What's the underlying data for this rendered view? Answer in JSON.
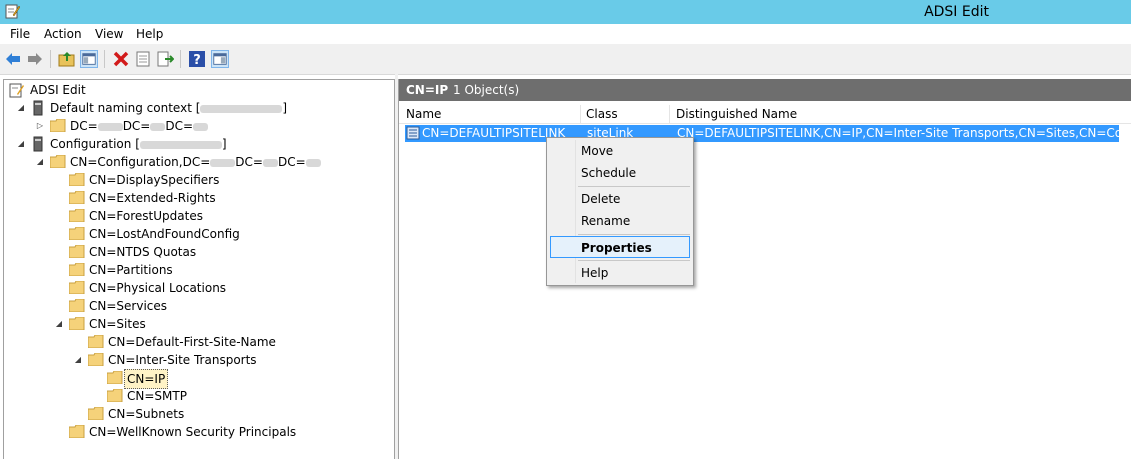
{
  "window": {
    "title": "ADSI Edit"
  },
  "menu": [
    "File",
    "Action",
    "View",
    "Help"
  ],
  "toolbar": [
    "back-arrow-icon",
    "forward-arrow-icon",
    "up-folder-icon",
    "show-hide-tree-icon",
    "delete-icon",
    "properties-sheet-icon",
    "export-list-icon",
    "help-icon",
    "show-hide-action-pane-icon"
  ],
  "tree": {
    "root": "ADSI Edit",
    "default_ctx": {
      "label": "Default naming context [",
      "close": "]"
    },
    "dc_node": {
      "p1": "DC=",
      "p2": "DC=",
      "p3": "DC="
    },
    "config_ctx": {
      "label": "Configuration [",
      "close": "]"
    },
    "config_node": {
      "p1": "CN=Configuration,DC=",
      "p2": "DC=",
      "p3": "DC="
    },
    "items": {
      "display_specifiers": "CN=DisplaySpecifiers",
      "extended_rights": "CN=Extended-Rights",
      "forest_updates": "CN=ForestUpdates",
      "lost_and_found": "CN=LostAndFoundConfig",
      "ntds_quotas": "CN=NTDS Quotas",
      "partitions": "CN=Partitions",
      "physical_locations": "CN=Physical Locations",
      "services": "CN=Services",
      "sites": "CN=Sites",
      "default_first_site": "CN=Default-First-Site-Name",
      "inter_site_transports": "CN=Inter-Site Transports",
      "ip": "CN=IP",
      "smtp": "CN=SMTP",
      "subnets": "CN=Subnets",
      "wellknown": "CN=WellKnown Security Principals"
    }
  },
  "results": {
    "title": "CN=IP",
    "count": "1 Object(s)",
    "columns": [
      "Name",
      "Class",
      "Distinguished Name"
    ],
    "rows": [
      {
        "name": "CN=DEFAULTIPSITELINK",
        "class": "siteLink",
        "dn": "CN=DEFAULTIPSITELINK,CN=IP,CN=Inter-Site Transports,CN=Sites,CN=Configu..."
      }
    ]
  },
  "context_menu": {
    "items": [
      "Move",
      "Schedule",
      "Delete",
      "Rename",
      "Properties",
      "Help"
    ],
    "highlighted": "Properties"
  },
  "colors": {
    "titlebar": "#69cbe8",
    "selection": "#3399ff",
    "header_band": "#6e6e6e"
  }
}
